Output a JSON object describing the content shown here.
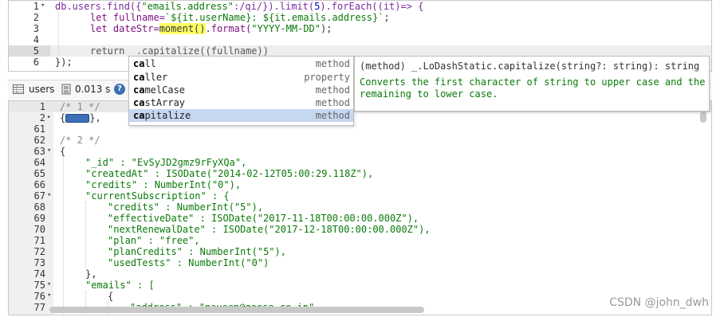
{
  "editor": {
    "line_numbers": [
      "1",
      "2",
      "3",
      "4",
      "5",
      "6"
    ],
    "line1": {
      "a": "db.users.find({",
      "b": "\"emails.address\"",
      "c": ":/qi/}).limit(",
      "d": "5",
      "e": ").forEach((it)=> {"
    },
    "line2": {
      "a": "let fullname=",
      "b": "`${it.userName}: ${it.emails.address}`",
      "c": ";"
    },
    "line3": {
      "a": "let dateStr=",
      "b": "moment()",
      "c": ".format(",
      "d": "\"YYYY-MM-DD\"",
      "e": ");"
    },
    "line5": "return _.capitalize((fullname))",
    "line6": "});"
  },
  "toolbar": {
    "collection": "users",
    "time": "0.013 s"
  },
  "results": {
    "line_numbers": [
      "1",
      "2",
      "61",
      "62",
      "63",
      "64",
      "65",
      "66",
      "67",
      "68",
      "69",
      "70",
      "71",
      "72",
      "73",
      "74",
      "75",
      "76",
      "77"
    ],
    "lines": [
      "/* 1 */",
      "{",
      "",
      "/* 2 */",
      "{",
      "\"_id\" : \"EvSyJD2gmz9rFyXQa\",",
      "\"createdAt\" : ISODate(\"2014-02-12T05:00:29.118Z\"),",
      "\"credits\" : NumberInt(\"0\"),",
      "\"currentSubscription\" : {",
      "\"credits\" : NumberInt(\"5\"),",
      "\"effectiveDate\" : ISODate(\"2017-11-18T00:00:00.000Z\"),",
      "\"nextRenewalDate\" : ISODate(\"2017-12-18T00:00:00.000Z\"),",
      "\"plan\" : \"free\",",
      "\"planCredits\" : NumberInt(\"5\"),",
      "\"usedTests\" : NumberInt(\"0\")",
      "},",
      "\"emails\" : [",
      "{",
      "\"address\" : \"naveen@goose.co.in\","
    ],
    "line2_suffix": "},"
  },
  "autocomplete": {
    "items": [
      {
        "match": "ca",
        "rest": "ll",
        "type": "method"
      },
      {
        "match": "ca",
        "rest": "ller",
        "type": "property"
      },
      {
        "match": "ca",
        "rest": "melCase",
        "type": "method"
      },
      {
        "match": "ca",
        "rest": "stArray",
        "type": "method"
      },
      {
        "match": "ca",
        "rest": "pitalize",
        "type": "method"
      }
    ]
  },
  "tooltip": {
    "signature": "(method) _.LoDashStatic.capitalize(string?: string): string",
    "doc": "Converts the first character of string to upper case and the remaining to lower case."
  },
  "watermark": "CSDN @john_dwh"
}
